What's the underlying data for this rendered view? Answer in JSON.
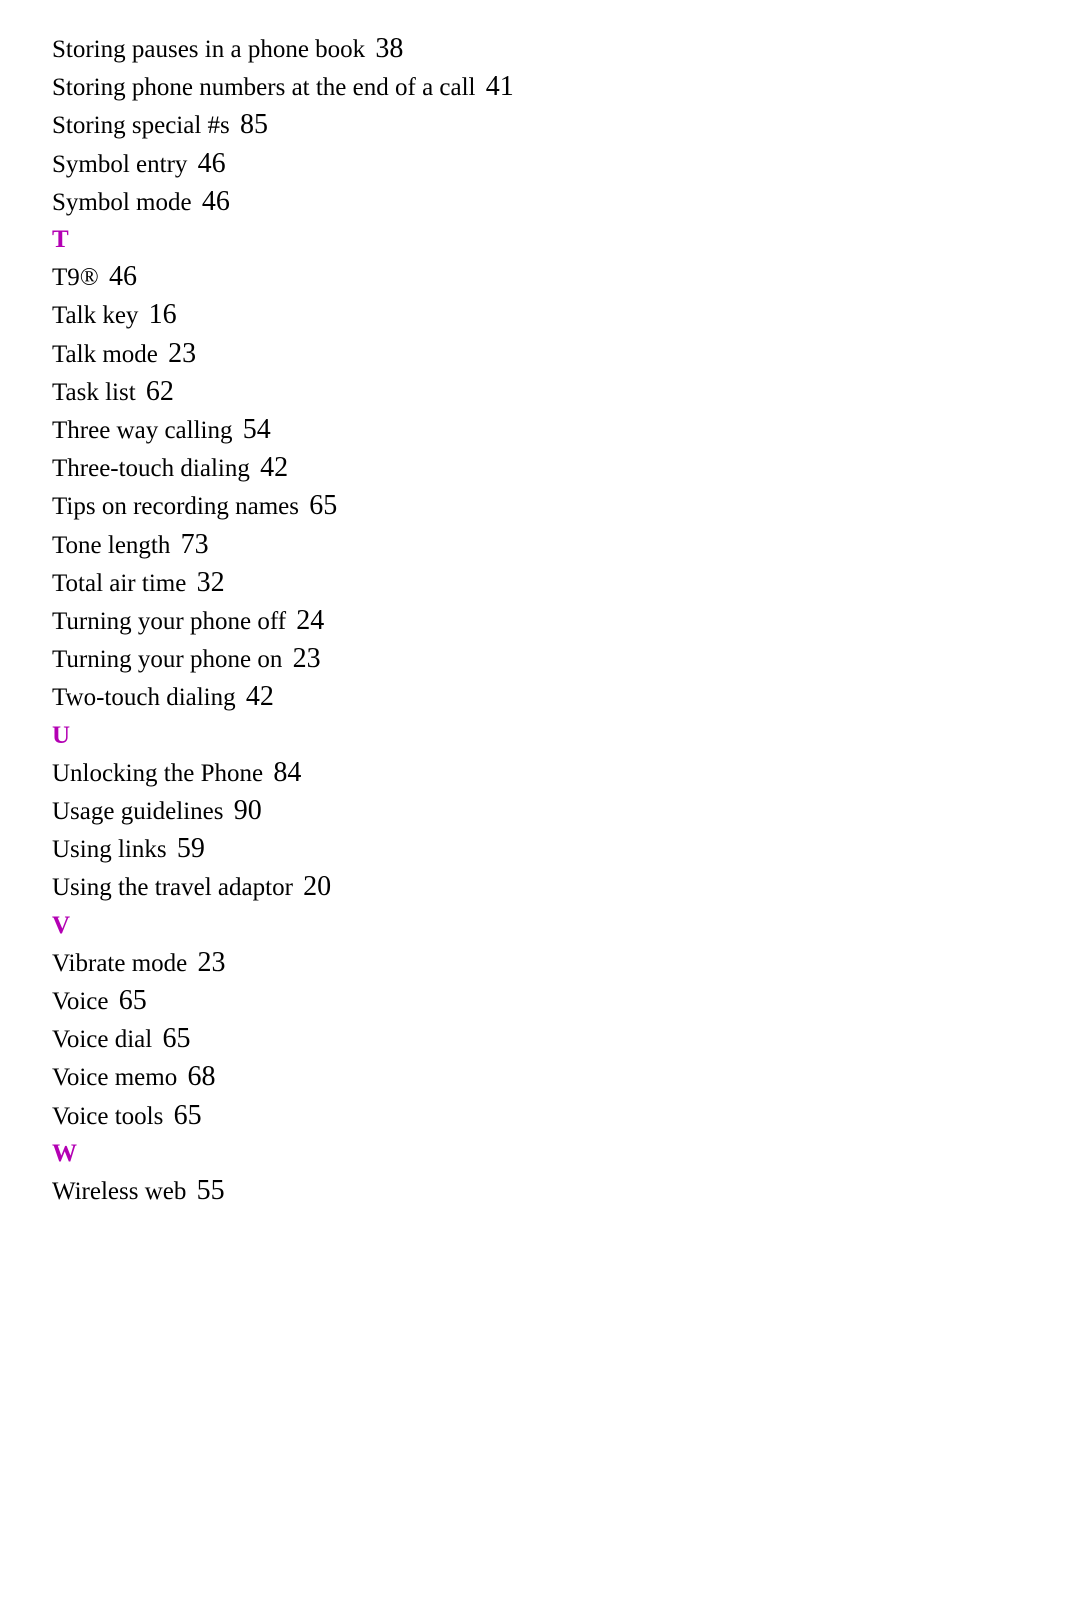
{
  "index": {
    "preEntries": [
      {
        "text": "Storing pauses in a phone book",
        "page": "38"
      },
      {
        "text": "Storing phone numbers at the end of a call",
        "page": "41"
      },
      {
        "text": "Storing special #s",
        "page": "85"
      },
      {
        "text": "Symbol entry",
        "page": "46"
      },
      {
        "text": "Symbol mode",
        "page": "46"
      }
    ],
    "sections": [
      {
        "letter": "T",
        "entries": [
          {
            "text": "T9®",
            "page": "46"
          },
          {
            "text": "Talk key",
            "page": "16"
          },
          {
            "text": "Talk mode",
            "page": "23"
          },
          {
            "text": "Task list",
            "page": "62"
          },
          {
            "text": "Three way calling",
            "page": "54"
          },
          {
            "text": "Three-touch dialing",
            "page": "42"
          },
          {
            "text": "Tips on recording names",
            "page": "65"
          },
          {
            "text": "Tone length",
            "page": "73"
          },
          {
            "text": "Total air time",
            "page": "32"
          },
          {
            "text": "Turning your phone off",
            "page": "24"
          },
          {
            "text": "Turning your phone on",
            "page": "23"
          },
          {
            "text": "Two-touch dialing",
            "page": "42"
          }
        ]
      },
      {
        "letter": "U",
        "entries": [
          {
            "text": "Unlocking the Phone",
            "page": "84"
          },
          {
            "text": "Usage guidelines",
            "page": "90"
          },
          {
            "text": "Using links",
            "page": "59"
          },
          {
            "text": "Using the travel adaptor",
            "page": "20"
          }
        ]
      },
      {
        "letter": "V",
        "entries": [
          {
            "text": "Vibrate mode",
            "page": "23"
          },
          {
            "text": "Voice",
            "page": "65"
          },
          {
            "text": "Voice dial",
            "page": "65"
          },
          {
            "text": "Voice memo",
            "page": "68"
          },
          {
            "text": "Voice tools",
            "page": "65"
          }
        ]
      },
      {
        "letter": "W",
        "entries": [
          {
            "text": "Wireless web",
            "page": "55"
          }
        ]
      }
    ]
  }
}
